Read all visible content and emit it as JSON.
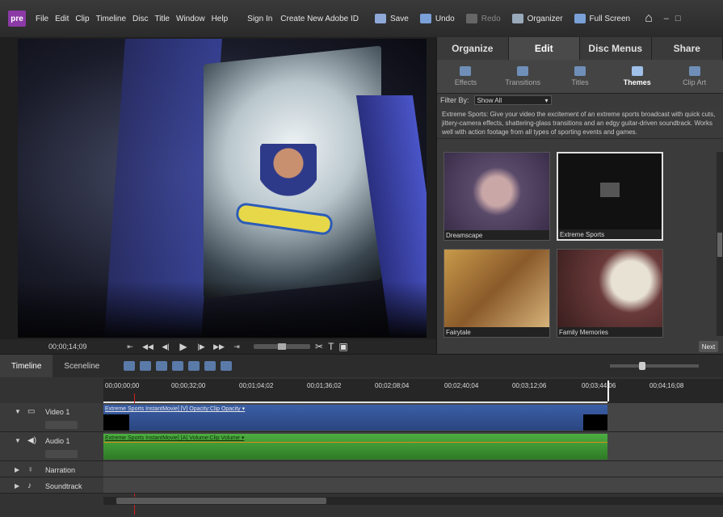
{
  "app": {
    "logo": "pre"
  },
  "menu": [
    "File",
    "Edit",
    "Clip",
    "Timeline",
    "Disc",
    "Title",
    "Window",
    "Help"
  ],
  "account": {
    "sign_in": "Sign In",
    "create_id": "Create New Adobe ID"
  },
  "toolbar": {
    "save": "Save",
    "undo": "Undo",
    "redo": "Redo",
    "organizer": "Organizer",
    "full_screen": "Full Screen"
  },
  "monitor": {
    "timecode": "00;00;14;09"
  },
  "tasks": {
    "tabs": [
      "Organize",
      "Edit",
      "Disc Menus",
      "Share"
    ],
    "active": "Edit",
    "subtabs": [
      "Effects",
      "Transitions",
      "Titles",
      "Themes",
      "Clip Art"
    ],
    "active_subtab": "Themes",
    "filter_label": "Filter By:",
    "filter_value": "Show All",
    "description": "Extreme Sports: Give your video the excitement of an extreme sports broadcast with quick cuts, jittery-camera effects, shattering-glass transitions and an edgy guitar-driven soundtrack. Works well with action footage from all types of sporting events and games.",
    "themes": [
      "Dreamscape",
      "Extreme Sports",
      "Fairytale",
      "Family Memories"
    ],
    "next": "Next"
  },
  "timeline": {
    "tabs": [
      "Timeline",
      "Sceneline"
    ],
    "active": "Timeline",
    "ticks": [
      "00;00;00;00",
      "00;00;32;00",
      "00;01;04;02",
      "00;01;36;02",
      "00;02;08;04",
      "00;02;40;04",
      "00;03;12;06",
      "00;03;44;06",
      "00;04;16;08"
    ],
    "tracks": {
      "video1": "Video 1",
      "audio1": "Audio 1",
      "narration": "Narration",
      "soundtrack": "Soundtrack"
    },
    "video_clip_label": "Extreme Sports InstantMovie] [V]  Opacity:Clip Opacity ▾",
    "audio_clip_label": "Extreme Sports InstantMovie] [A]  Volume:Clip Volume ▾"
  }
}
